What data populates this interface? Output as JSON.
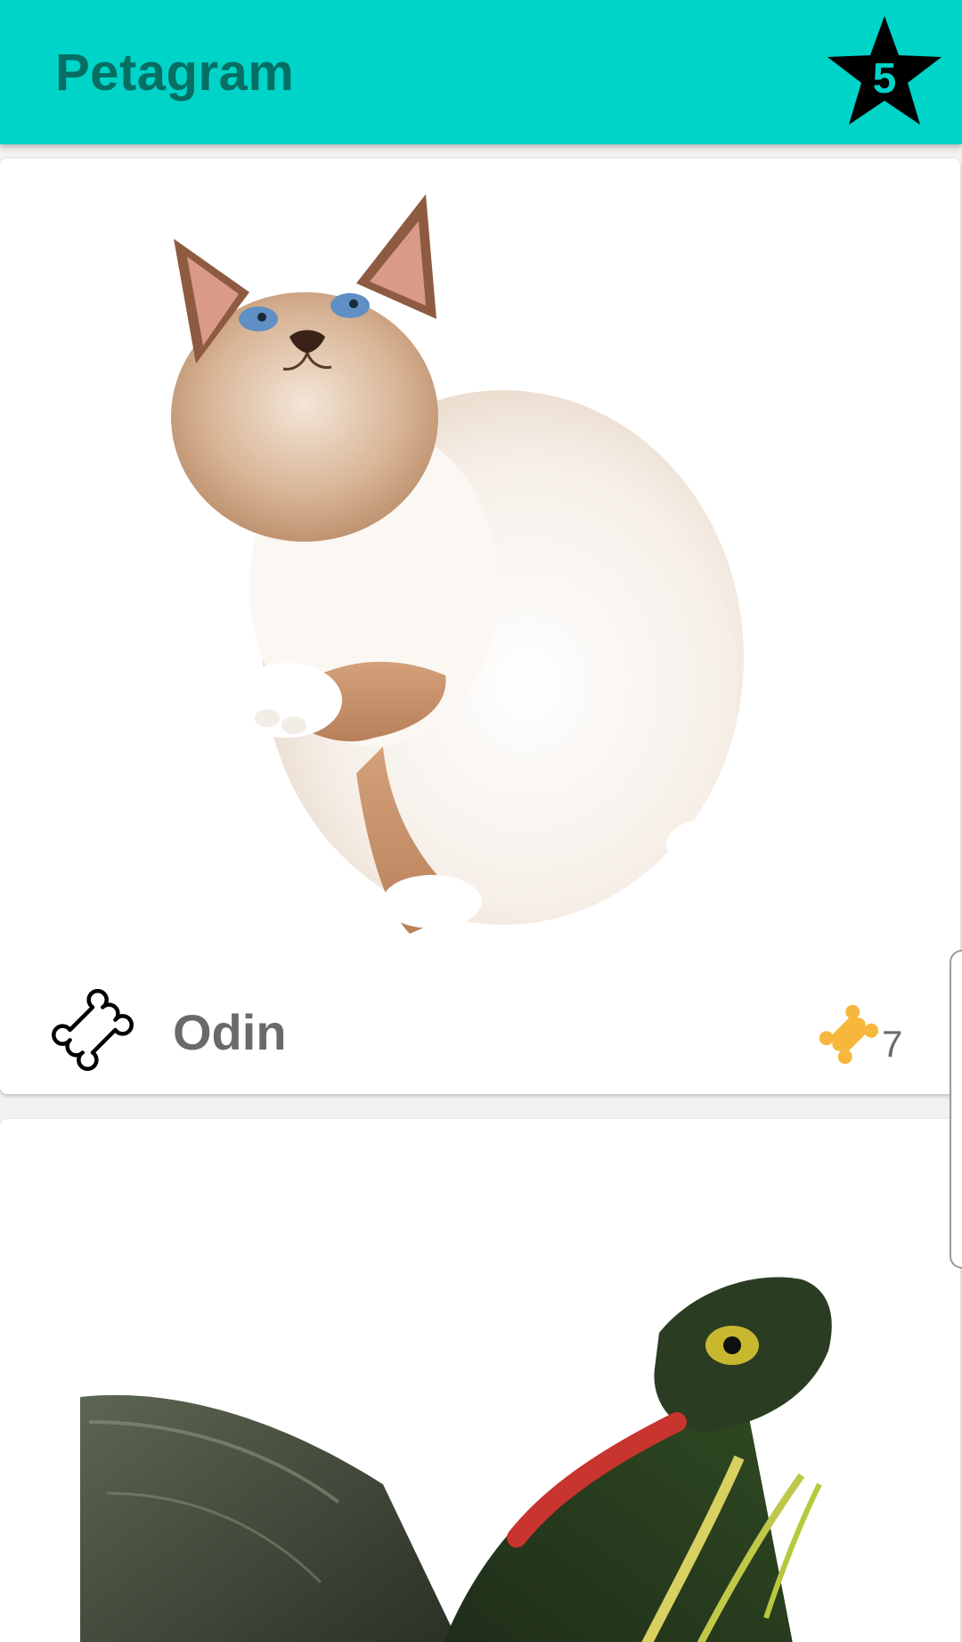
{
  "app_bar": {
    "title": "Petagram",
    "favorites_count": "5",
    "background_color": "#00d4c8",
    "title_color": "#066e63"
  },
  "pets": [
    {
      "name": "Odin",
      "likes": "7",
      "photo": "kitten-photo",
      "like_icon": "bone-outline-icon",
      "rating_icon": "bone-filled-icon"
    },
    {
      "photo": "turtle-photo"
    }
  ],
  "colors": {
    "accent": "#00d4c8",
    "bone_gold": "#f6b73c",
    "text_gray": "#6a6a6a"
  }
}
